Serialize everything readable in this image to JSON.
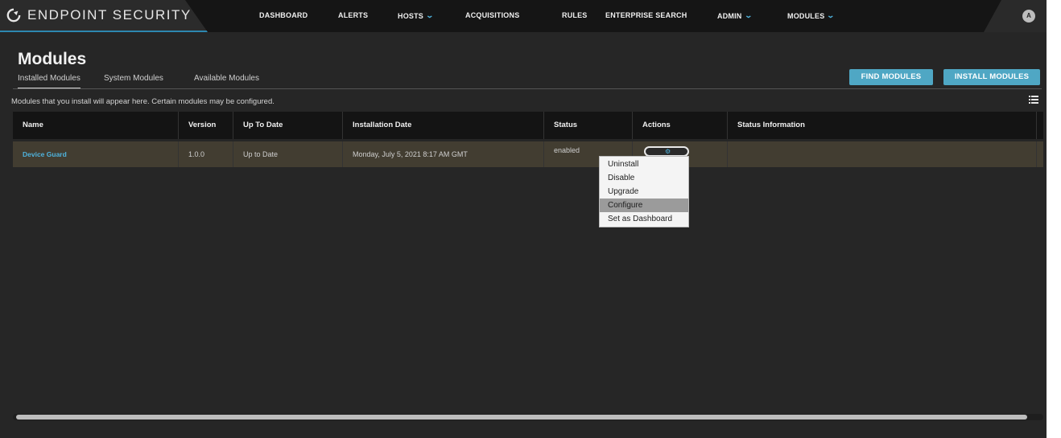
{
  "app": {
    "brand": "ENDPOINT SECURITY",
    "nav": [
      {
        "label": "DASHBOARD",
        "dropdown": false
      },
      {
        "label": "ALERTS",
        "dropdown": false
      },
      {
        "label": "HOSTS",
        "dropdown": true
      },
      {
        "label": "ACQUISITIONS",
        "dropdown": false
      },
      {
        "label": "RULES",
        "dropdown": false
      },
      {
        "label": "ENTERPRISE SEARCH",
        "dropdown": false
      },
      {
        "label": "ADMIN",
        "dropdown": true
      },
      {
        "label": "MODULES",
        "dropdown": true
      }
    ],
    "avatar": "A"
  },
  "page": {
    "title": "Modules",
    "tabs": [
      "Installed Modules",
      "System Modules",
      "Available Modules"
    ],
    "active_tab": "Installed Modules",
    "buttons": {
      "find": "FIND MODULES",
      "install": "INSTALL MODULES"
    },
    "hint": "Modules that you install will appear here. Certain modules may be configured."
  },
  "table": {
    "columns": [
      "Name",
      "Version",
      "Up To Date",
      "Installation Date",
      "Status",
      "Actions",
      "Status Information"
    ],
    "rows": [
      {
        "name": "Device Guard",
        "version": "1.0.0",
        "up_to_date": "Up to Date",
        "installation_date": "Monday, July 5, 2021 8:17 AM GMT",
        "status": "enabled",
        "status_information": ""
      }
    ]
  },
  "actions_menu": {
    "items": [
      "Uninstall",
      "Disable",
      "Upgrade",
      "Configure",
      "Set as Dashboard"
    ],
    "highlighted": "Configure"
  },
  "colors": {
    "accent": "#4fa7c4",
    "link": "#4fb3dd",
    "row_bg": "#423d31",
    "page_bg": "#262626"
  },
  "icons": {
    "brand": "endpoint-logo-icon",
    "actions": "gear-icon",
    "view": "list-view-icon",
    "dropdown": "chevron-down-icon"
  }
}
